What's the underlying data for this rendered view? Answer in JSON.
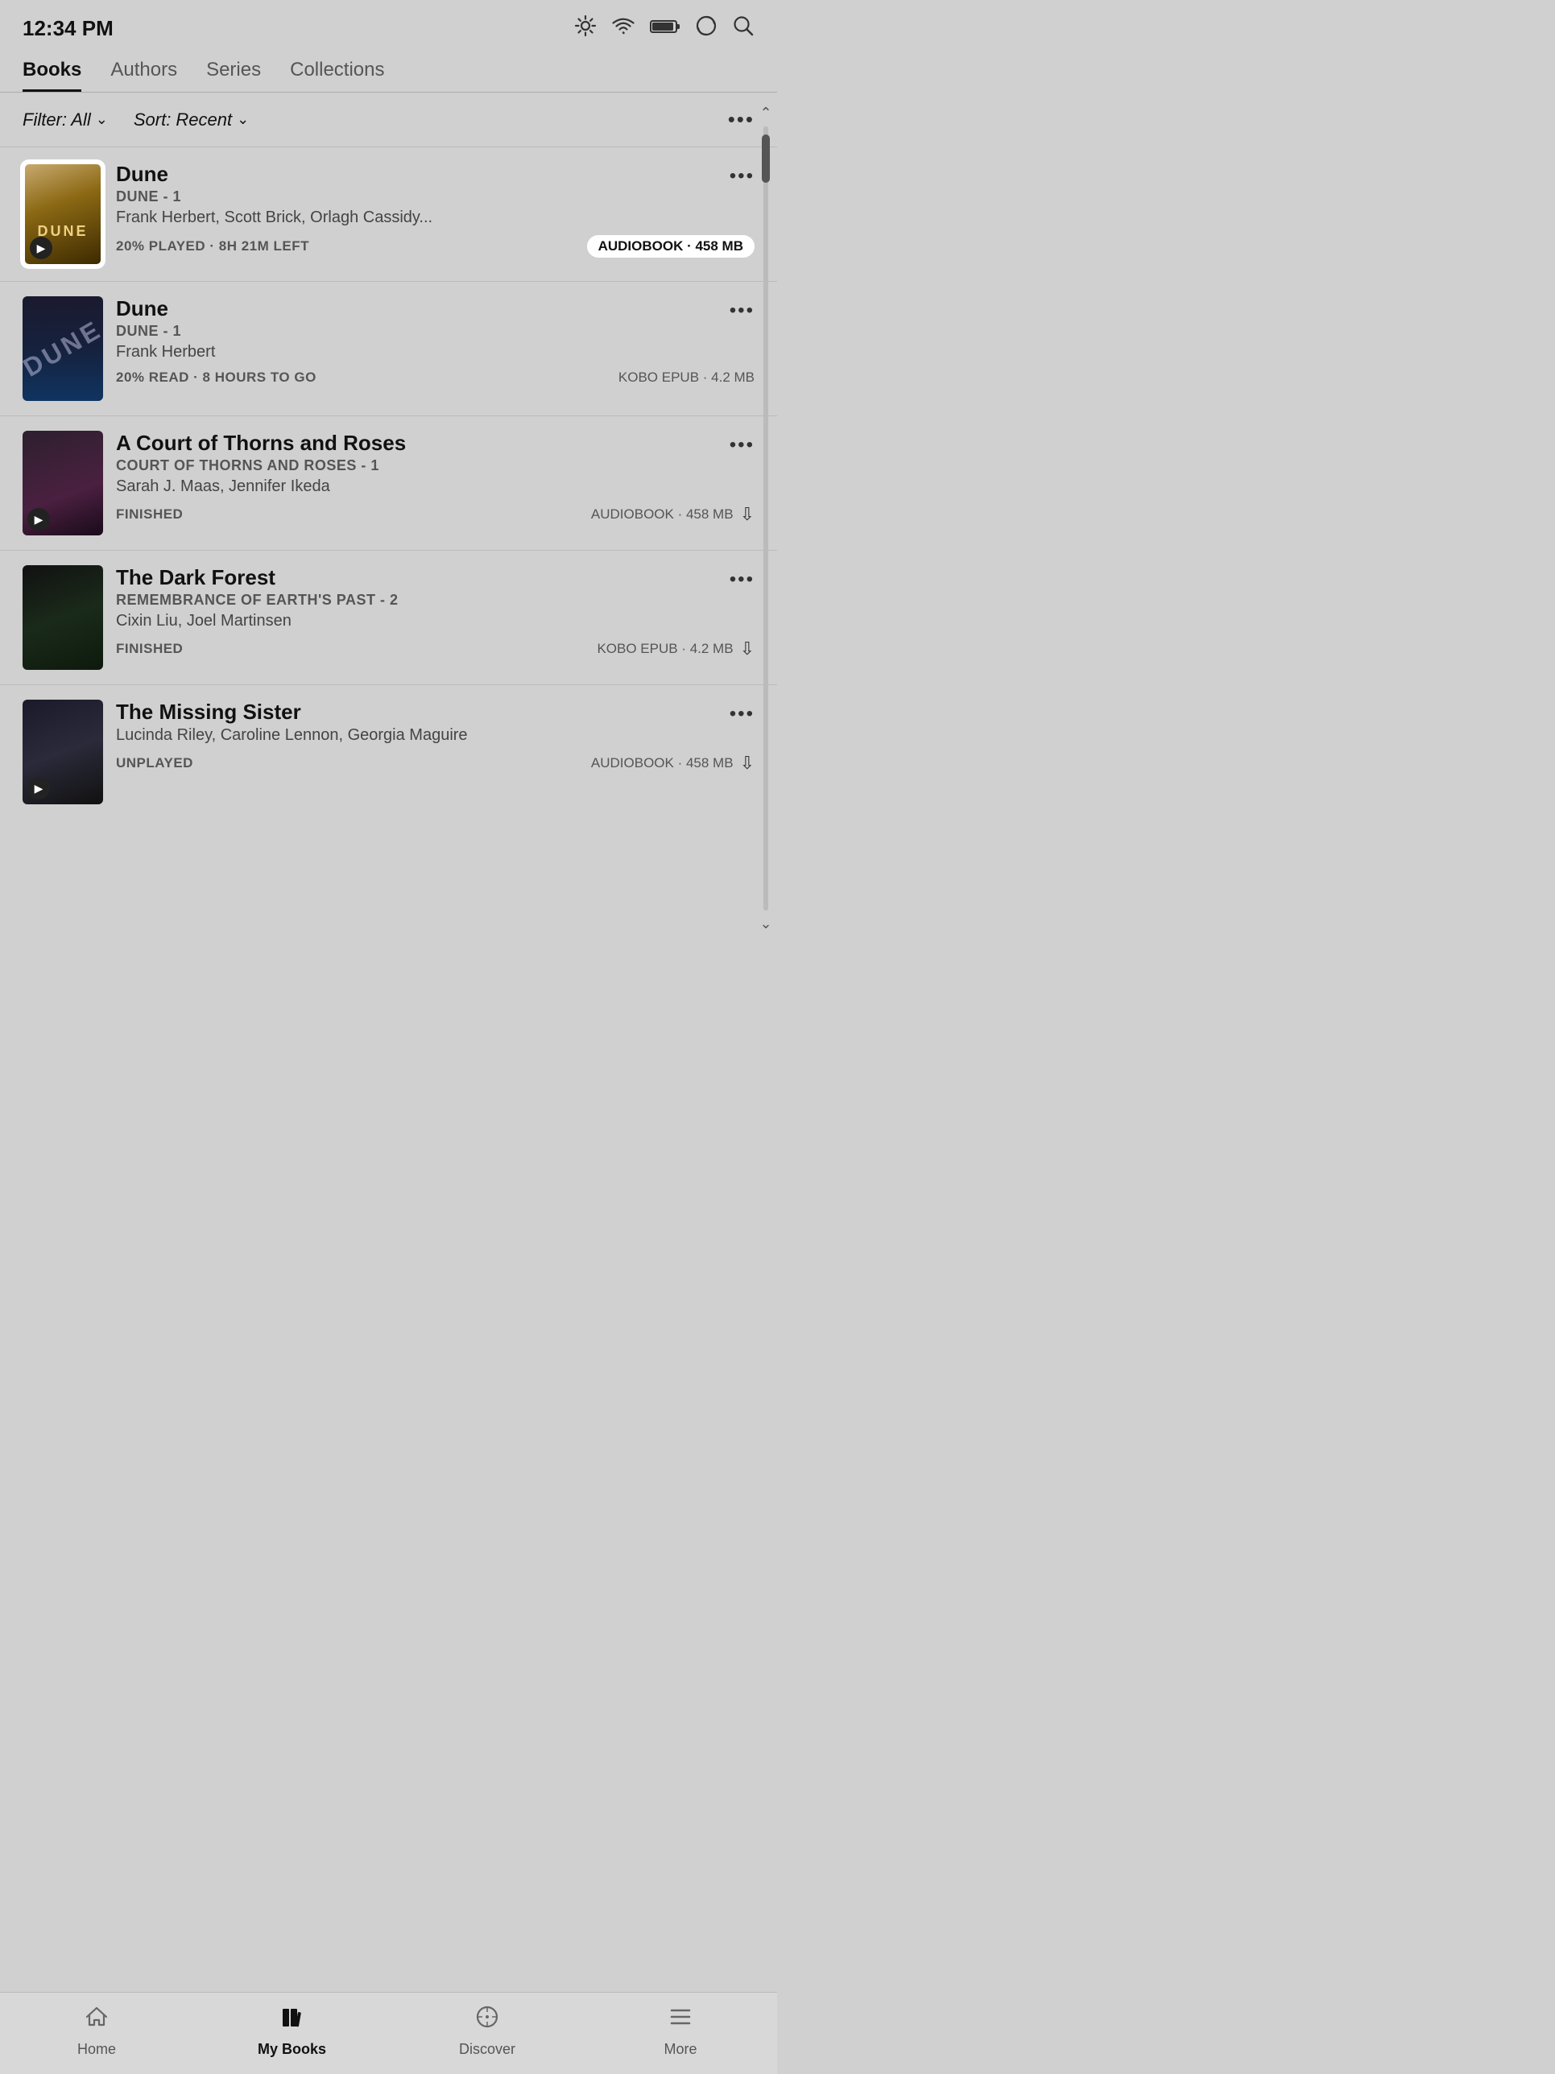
{
  "statusBar": {
    "time": "12:34 PM"
  },
  "tabs": [
    {
      "id": "books",
      "label": "Books",
      "active": true
    },
    {
      "id": "authors",
      "label": "Authors",
      "active": false
    },
    {
      "id": "series",
      "label": "Series",
      "active": false
    },
    {
      "id": "collections",
      "label": "Collections",
      "active": false
    }
  ],
  "filter": {
    "filterLabel": "Filter: All",
    "sortLabel": "Sort: Recent",
    "moreLabel": "•••"
  },
  "books": [
    {
      "id": "dune-audio",
      "title": "Dune",
      "series": "DUNE - 1",
      "authors": "Frank Herbert, Scott Brick, Orlagh Cassidy...",
      "status": "20% PLAYED · 8H 21M LEFT",
      "formatLabel": "AUDIOBOOK · 458 MB",
      "formatType": "audiobook-pill",
      "coverType": "dune-audio",
      "hasAudioBadge": true,
      "highlighted": true
    },
    {
      "id": "dune-epub",
      "title": "Dune",
      "series": "DUNE - 1",
      "authors": "Frank Herbert",
      "status": "20% READ · 8 HOURS TO GO",
      "formatLabel": "KOBO EPUB · 4.2 MB",
      "formatType": "text",
      "coverType": "dune-epub",
      "hasAudioBadge": false,
      "highlighted": false
    },
    {
      "id": "acotars",
      "title": "A Court of Thorns and Roses",
      "series": "COURT OF THORNS AND ROSES - 1",
      "authors": "Sarah J. Maas, Jennifer Ikeda",
      "status": "FINISHED",
      "formatLabel": "AUDIOBOOK · 458 MB",
      "formatType": "text",
      "coverType": "acotars",
      "hasAudioBadge": true,
      "highlighted": false,
      "showDownload": true
    },
    {
      "id": "darkforest",
      "title": "The Dark Forest",
      "series": "REMEMBRANCE OF EARTH'S PAST - 2",
      "authors": "Cixin Liu, Joel Martinsen",
      "status": "FINISHED",
      "formatLabel": "KOBO EPUB · 4.2 MB",
      "formatType": "text",
      "coverType": "darkforest",
      "hasAudioBadge": false,
      "highlighted": false,
      "showDownload": true
    },
    {
      "id": "missingsister",
      "title": "The Missing Sister",
      "series": "",
      "authors": "Lucinda Riley, Caroline Lennon, Georgia Maguire",
      "status": "UNPLAYED",
      "formatLabel": "AUDIOBOOK · 458 MB",
      "formatType": "text",
      "coverType": "missingsister",
      "hasAudioBadge": true,
      "highlighted": false,
      "showDownload": true
    }
  ],
  "bottomNav": [
    {
      "id": "home",
      "label": "Home",
      "icon": "home",
      "active": false
    },
    {
      "id": "mybooks",
      "label": "My Books",
      "icon": "mybooks",
      "active": true
    },
    {
      "id": "discover",
      "label": "Discover",
      "icon": "discover",
      "active": false
    },
    {
      "id": "more",
      "label": "More",
      "icon": "more",
      "active": false
    }
  ]
}
